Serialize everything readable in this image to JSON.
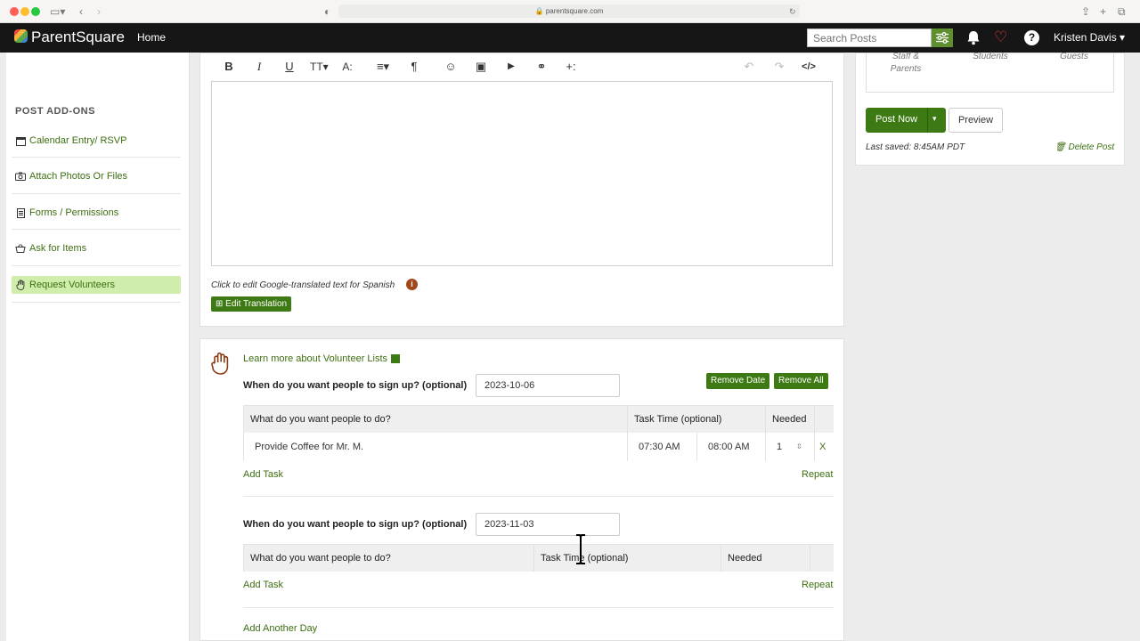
{
  "browser": {
    "url": "parentsquare.com"
  },
  "nav": {
    "brand": "ParentSquare",
    "home": "Home",
    "search_placeholder": "Search Posts",
    "user": "Kristen Davis"
  },
  "sidebar": {
    "title": "POST ADD-ONS",
    "items": [
      {
        "label": "Calendar Entry/ RSVP",
        "icon": "calendar-icon"
      },
      {
        "label": "Attach Photos Or Files",
        "icon": "camera-icon"
      },
      {
        "label": "Forms / Permissions",
        "icon": "document-icon"
      },
      {
        "label": "Ask for Items",
        "icon": "basket-icon"
      },
      {
        "label": "Request Volunteers",
        "icon": "hand-icon",
        "active": true
      }
    ]
  },
  "editor": {
    "toolbar": [
      "B",
      "I",
      "U",
      "TT",
      "A:",
      "≡",
      "¶",
      "☺",
      "▣",
      "▶",
      "⚭",
      "+:",
      "↶",
      "↷",
      "</>"
    ],
    "translate_note": "Click to edit Google-translated text for Spanish",
    "edit_translation": "Edit Translation"
  },
  "volunteer": {
    "learn_more": "Learn more about Volunteer Lists",
    "question": "When do you want people to sign up? (optional)",
    "remove_date": "Remove Date",
    "remove_all": "Remove All",
    "col_task": "What do you want people to do?",
    "col_time": "Task Time (optional)",
    "col_needed": "Needed",
    "add_task": "Add Task",
    "repeat": "Repeat",
    "add_another_day": "Add Another Day",
    "days": [
      {
        "date": "2023-10-06",
        "task": "Provide Coffee for Mr. M.",
        "start": "07:30 AM",
        "end": "08:00 AM",
        "needed": "1",
        "remove": "X"
      },
      {
        "date": "2023-11-03"
      }
    ]
  },
  "right_panel": {
    "audiences": [
      "Staff & Parents",
      "Students",
      "Guests"
    ],
    "post_now": "Post Now",
    "preview": "Preview",
    "last_saved": "Last saved: 8:45AM PDT",
    "delete_post": "Delete Post"
  },
  "colors": {
    "brand_green": "#3e7a13",
    "active_bg": "#cfeeab",
    "nav_bg": "#161616"
  }
}
